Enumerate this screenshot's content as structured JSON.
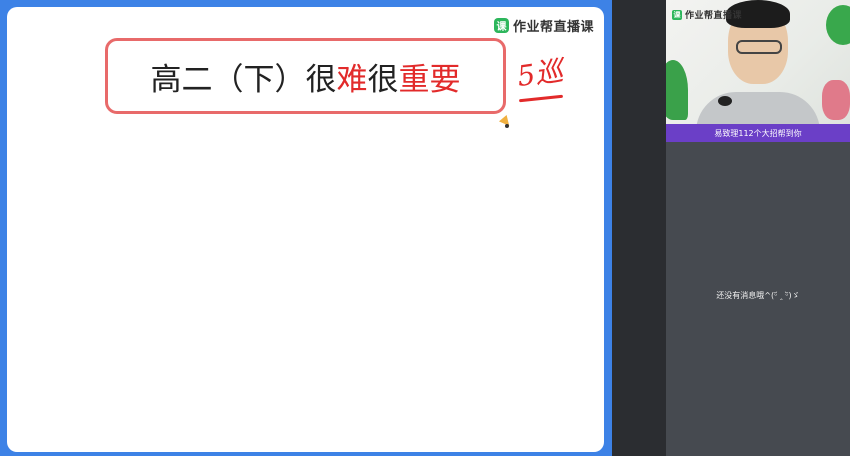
{
  "board": {
    "logo_text": "作业帮直播课",
    "title_parts": [
      "高二（下）很",
      "难",
      "很",
      "重要"
    ],
    "scribble": "5巡"
  },
  "video": {
    "logo_text": "作业帮直播课",
    "banner": "易致理112个大招帮到你"
  },
  "chat": {
    "empty_message": "还没有消息哦^(ᵕ᷄ ‸ ᵕ᷅)ゞ"
  },
  "colors": {
    "board_border": "#3d82e6",
    "title_box_border": "#e86a6a",
    "accent_red": "#e22a2a",
    "brand_green": "#2db65c",
    "banner_purple": "#6b3fc7"
  }
}
